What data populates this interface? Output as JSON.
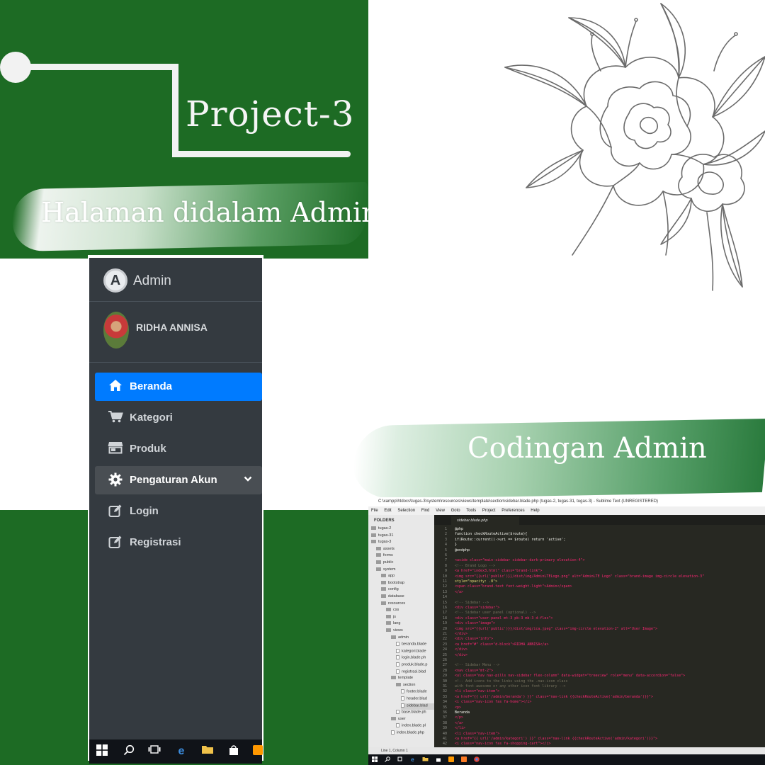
{
  "header": {
    "project_title": "Project-3",
    "subtitle": "Halaman didalam Admin"
  },
  "caption": {
    "coding_label": "Codingan Admin"
  },
  "sidebar": {
    "brand": "Admin",
    "brand_logo_letter": "A",
    "user_name": "RIDHA ANNISA",
    "active_color": "#007bff",
    "background_color": "#343a40",
    "items": [
      {
        "label": "Beranda",
        "icon": "home-icon",
        "state": "active"
      },
      {
        "label": "Kategori",
        "icon": "shopping-cart-icon",
        "state": "normal"
      },
      {
        "label": "Produk",
        "icon": "store-icon",
        "state": "normal"
      },
      {
        "label": "Pengaturan Akun",
        "icon": "gear-icon",
        "state": "expanded",
        "has_caret": true
      },
      {
        "label": "Login",
        "icon": "edit-icon",
        "state": "normal"
      },
      {
        "label": "Registrasi",
        "icon": "edit-icon",
        "state": "normal"
      }
    ]
  },
  "editor": {
    "window_title": "C:\\xampp\\htdocs\\tugas-3\\system\\resources\\views\\template\\section\\sidebar.blade.php (tugas-2, tugas-31, tugas-3) - Sublime Text (UNREGISTERED)",
    "menu": [
      "File",
      "Edit",
      "Selection",
      "Find",
      "View",
      "Goto",
      "Tools",
      "Project",
      "Preferences",
      "Help"
    ],
    "folders_heading": "FOLDERS",
    "tab_label": "sidebar.blade.php",
    "status_text": "Line 1, Column 1",
    "tree": [
      {
        "label": "tugas-2",
        "type": "folder",
        "depth": 0
      },
      {
        "label": "tugas-31",
        "type": "folder",
        "depth": 0
      },
      {
        "label": "tugas-3",
        "type": "folder",
        "depth": 0
      },
      {
        "label": "assets",
        "type": "folder",
        "depth": 1
      },
      {
        "label": "forms",
        "type": "folder",
        "depth": 1
      },
      {
        "label": "public",
        "type": "folder",
        "depth": 1
      },
      {
        "label": "system",
        "type": "folder",
        "depth": 1
      },
      {
        "label": "app",
        "type": "folder",
        "depth": 2
      },
      {
        "label": "bootstrap",
        "type": "folder",
        "depth": 2
      },
      {
        "label": "config",
        "type": "folder",
        "depth": 2
      },
      {
        "label": "database",
        "type": "folder",
        "depth": 2
      },
      {
        "label": "resources",
        "type": "folder",
        "depth": 2
      },
      {
        "label": "css",
        "type": "folder",
        "depth": 3
      },
      {
        "label": "js",
        "type": "folder",
        "depth": 3
      },
      {
        "label": "lang",
        "type": "folder",
        "depth": 3
      },
      {
        "label": "views",
        "type": "folder",
        "depth": 3
      },
      {
        "label": "admin",
        "type": "folder",
        "depth": 4
      },
      {
        "label": "beranda.blade",
        "type": "file",
        "depth": 5
      },
      {
        "label": "kategori.blade",
        "type": "file",
        "depth": 5
      },
      {
        "label": "login.blade.ph",
        "type": "file",
        "depth": 5
      },
      {
        "label": "produk.blade.p",
        "type": "file",
        "depth": 5
      },
      {
        "label": "registrasi.blad",
        "type": "file",
        "depth": 5
      },
      {
        "label": "template",
        "type": "folder",
        "depth": 4
      },
      {
        "label": "section",
        "type": "folder",
        "depth": 5
      },
      {
        "label": "footer.blade",
        "type": "file",
        "depth": 6
      },
      {
        "label": "header.blad",
        "type": "file",
        "depth": 6
      },
      {
        "label": "sidebar.blad",
        "type": "file",
        "depth": 6,
        "selected": true
      },
      {
        "label": "base.blade.ph",
        "type": "file",
        "depth": 5
      },
      {
        "label": "user",
        "type": "folder",
        "depth": 4
      },
      {
        "label": "index.blade.pl",
        "type": "file",
        "depth": 5
      },
      {
        "label": "index.blade.php",
        "type": "file",
        "depth": 4
      }
    ],
    "code_lines": [
      {
        "text": "@php",
        "kind": "plain"
      },
      {
        "text": "  function checkRouteActive($route){",
        "kind": "plain"
      },
      {
        "text": "  if(Route::current()->uri == $route) return 'active';",
        "kind": "plain"
      },
      {
        "text": "  }",
        "kind": "plain"
      },
      {
        "text": "@endphp",
        "kind": "plain"
      },
      {
        "text": "",
        "kind": "plain"
      },
      {
        "text": "<aside class=\"main-sidebar sidebar-dark-primary elevation-4\">",
        "kind": "tag"
      },
      {
        "text": "    <!-- Brand Logo -->",
        "kind": "comment"
      },
      {
        "text": "    <a href=\"index3.html\" class=\"brand-link\">",
        "kind": "tag"
      },
      {
        "text": "      <img src=\"{{url('public')}}/dist/img/AdminLTELogo.png\" alt=\"AdminLTE Logo\" class=\"brand-image img-circle elevation-3\"",
        "kind": "tag"
      },
      {
        "text": "           style=\"opacity: .8\">",
        "kind": "string"
      },
      {
        "text": "      <span class=\"brand-text font-weight-light\">Admin</span>",
        "kind": "tag"
      },
      {
        "text": "    </a>",
        "kind": "tag"
      },
      {
        "text": "",
        "kind": "plain"
      },
      {
        "text": "    <!-- Sidebar -->",
        "kind": "comment"
      },
      {
        "text": "    <div class=\"sidebar\">",
        "kind": "tag"
      },
      {
        "text": "      <!-- Sidebar user panel (optional) -->",
        "kind": "comment"
      },
      {
        "text": "      <div class=\"user-panel mt-3 pb-3 mb-3 d-flex\">",
        "kind": "tag"
      },
      {
        "text": "        <div class=\"image\">",
        "kind": "tag"
      },
      {
        "text": "          <img src=\"{{url('public')}}/dist/img/ica.jpeg\" class=\"img-circle elevation-2\" alt=\"User Image\">",
        "kind": "tag"
      },
      {
        "text": "        </div>",
        "kind": "tag"
      },
      {
        "text": "        <div class=\"info\">",
        "kind": "tag"
      },
      {
        "text": "          <a href=\"#\" class=\"d-block\">RIDHA ANNISA</a>",
        "kind": "tag"
      },
      {
        "text": "        </div>",
        "kind": "tag"
      },
      {
        "text": "      </div>",
        "kind": "tag"
      },
      {
        "text": "",
        "kind": "plain"
      },
      {
        "text": "      <!-- Sidebar Menu -->",
        "kind": "comment"
      },
      {
        "text": "      <nav class=\"mt-2\">",
        "kind": "tag"
      },
      {
        "text": "        <ul class=\"nav nav-pills nav-sidebar flex-column\" data-widget=\"treeview\" role=\"menu\" data-accordion=\"false\">",
        "kind": "tag"
      },
      {
        "text": "          <!-- Add icons to the links using the .nav-icon class",
        "kind": "comment"
      },
      {
        "text": "               with font-awesome or any other icon font library -->",
        "kind": "comment"
      },
      {
        "text": "          <li class=\"nav-item\">",
        "kind": "tag"
      },
      {
        "text": "            <a href=\"{{ url('/admin/beranda') }}\" class=\"nav-link {{checkRouteActive('admin/beranda')}}\">",
        "kind": "tag"
      },
      {
        "text": "              <i class=\"nav-icon fas fa-home\"></i>",
        "kind": "tag"
      },
      {
        "text": "              <p>",
        "kind": "tag"
      },
      {
        "text": "                Beranda",
        "kind": "plain"
      },
      {
        "text": "              </p>",
        "kind": "tag"
      },
      {
        "text": "            </a>",
        "kind": "tag"
      },
      {
        "text": "          </li>",
        "kind": "tag"
      },
      {
        "text": "          <li class=\"nav-item\">",
        "kind": "tag"
      },
      {
        "text": "            <a href=\"{{ url('/admin/kategori') }}\" class=\"nav-link {{checkRouteActive('admin/kategori')}}\">",
        "kind": "tag"
      },
      {
        "text": "              <i class=\"nav-icon fas fa-shopping-cart\"></i>",
        "kind": "tag"
      }
    ]
  }
}
